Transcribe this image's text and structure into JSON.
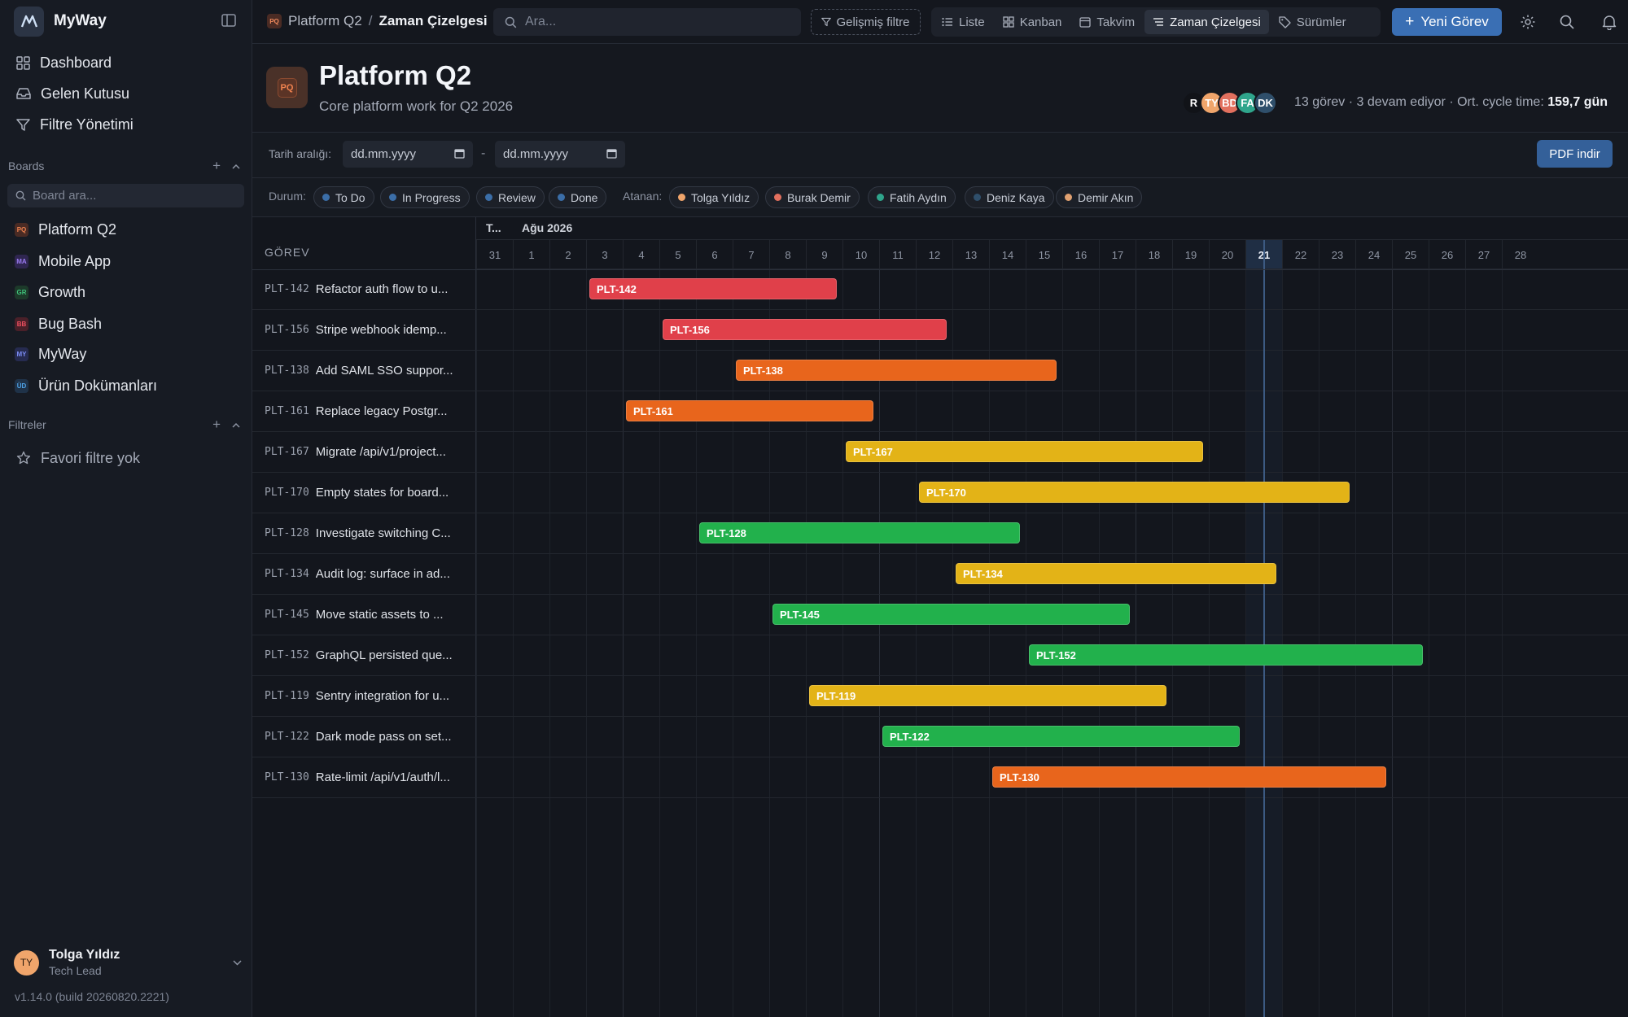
{
  "sidebar": {
    "brand": "MyWay",
    "nav": [
      {
        "label": "Dashboard",
        "icon": "grid-icon"
      },
      {
        "label": "Gelen Kutusu",
        "icon": "inbox-icon"
      },
      {
        "label": "Filtre Yönetimi",
        "icon": "filter-icon"
      }
    ],
    "boards_label": "Boards",
    "board_search_placeholder": "Board ara...",
    "boards": [
      {
        "label": "Platform Q2",
        "chip": "PQ",
        "color": "#f0834f",
        "bg": "#4a2b24"
      },
      {
        "label": "Mobile App",
        "chip": "MA",
        "color": "#9b7bf2",
        "bg": "#2f2650"
      },
      {
        "label": "Growth",
        "chip": "GR",
        "color": "#3fc07a",
        "bg": "#1d3a2a"
      },
      {
        "label": "Bug Bash",
        "chip": "BB",
        "color": "#ef5060",
        "bg": "#4a2029"
      },
      {
        "label": "MyWay",
        "chip": "MY",
        "color": "#7b8cf2",
        "bg": "#262b50"
      },
      {
        "label": "Ürün Dokümanları",
        "chip": "ÜD",
        "color": "#4fa3e8",
        "bg": "#1f3248"
      }
    ],
    "filters_label": "Filtreler",
    "no_favorites": "Favori filtre yok",
    "user": {
      "initials": "TY",
      "name": "Tolga Yıldız",
      "role": "Tech Lead"
    },
    "version": "v1.14.0 (build 20260820.2221)"
  },
  "topbar": {
    "breadcrumb_chip": "PQ",
    "breadcrumb_project": "Platform Q2",
    "breadcrumb_sep": "/",
    "breadcrumb_page": "Zaman Çizelgesi",
    "search_placeholder": "Ara...",
    "advanced_filter": "Gelişmiş filtre",
    "views": [
      {
        "label": "Liste",
        "icon": "list-icon",
        "active": false
      },
      {
        "label": "Kanban",
        "icon": "kanban-icon",
        "active": false
      },
      {
        "label": "Takvim",
        "icon": "calendar-icon",
        "active": false
      },
      {
        "label": "Zaman Çizelgesi",
        "icon": "timeline-icon",
        "active": true
      },
      {
        "label": "Sürümler",
        "icon": "tag-icon",
        "active": false
      }
    ],
    "new_task": "Yeni Görev"
  },
  "project": {
    "chip": "PQ",
    "title": "Platform Q2",
    "subtitle": "Core platform work for Q2 2026",
    "avatars": [
      {
        "initials": "R",
        "color": "#111318"
      },
      {
        "initials": "TY",
        "color": "#f0a56b"
      },
      {
        "initials": "BD",
        "color": "#e2705e"
      },
      {
        "initials": "FA",
        "color": "#2fa58c"
      },
      {
        "initials": "DK",
        "color": "#2f4f6b"
      }
    ],
    "stats_prefix": "13 görev · 3 devam ediyor · Ort. cycle time:",
    "stats_value": "159,7 gün"
  },
  "date_range": {
    "label": "Tarih aralığı:",
    "from_placeholder": "dd.mm.yyyy",
    "to_placeholder": "dd.mm.yyyy",
    "dash": "-",
    "pdf": "PDF indir"
  },
  "filters": {
    "status_label": "Durum:",
    "statuses": [
      {
        "label": "To Do",
        "color": "#3b6ea8"
      },
      {
        "label": "In Progress",
        "color": "#3b6ea8"
      },
      {
        "label": "Review",
        "color": "#3b6ea8"
      },
      {
        "label": "Done",
        "color": "#3b6ea8"
      }
    ],
    "assignee_label": "Atanan:",
    "assignees": [
      {
        "label": "Tolga Yıldız",
        "color": "#f0a56b"
      },
      {
        "label": "Burak Demir",
        "color": "#e2705e"
      },
      {
        "label": "Fatih Aydın",
        "color": "#2fa58c"
      },
      {
        "label": "Deniz Kaya",
        "color": "#2f4f6b"
      },
      {
        "label": "Demir Akın",
        "color": "#e0a070"
      }
    ]
  },
  "gantt": {
    "task_header": "GÖREV",
    "prev_month_label": "T...",
    "month_label": "Ağu 2026",
    "days": [
      "31",
      "1",
      "2",
      "3",
      "4",
      "5",
      "6",
      "7",
      "8",
      "9",
      "10",
      "11",
      "12",
      "13",
      "14",
      "15",
      "16",
      "17",
      "18",
      "19",
      "20",
      "21",
      "22",
      "23",
      "24",
      "25",
      "26",
      "27",
      "28"
    ],
    "today": "21",
    "tasks": [
      {
        "key": "PLT-142",
        "title": "Refactor auth flow to u...",
        "start": "3",
        "end": "9",
        "color": "#e0404a"
      },
      {
        "key": "PLT-156",
        "title": "Stripe webhook idemp...",
        "start": "5",
        "end": "12",
        "color": "#e0404a"
      },
      {
        "key": "PLT-138",
        "title": "Add SAML SSO suppor...",
        "start": "7",
        "end": "15",
        "color": "#e8651c"
      },
      {
        "key": "PLT-161",
        "title": "Replace legacy Postgr...",
        "start": "4",
        "end": "10",
        "color": "#e8651c"
      },
      {
        "key": "PLT-167",
        "title": "Migrate /api/v1/project...",
        "start": "10",
        "end": "19",
        "color": "#e3b317"
      },
      {
        "key": "PLT-170",
        "title": "Empty states for board...",
        "start": "12",
        "end": "23",
        "color": "#e3b317"
      },
      {
        "key": "PLT-128",
        "title": "Investigate switching C...",
        "start": "6",
        "end": "14",
        "color": "#22b14c"
      },
      {
        "key": "PLT-134",
        "title": "Audit log: surface in ad...",
        "start": "13",
        "end": "21",
        "color": "#e3b317"
      },
      {
        "key": "PLT-145",
        "title": "Move static assets to ...",
        "start": "8",
        "end": "17",
        "color": "#22b14c"
      },
      {
        "key": "PLT-152",
        "title": "GraphQL persisted que...",
        "start": "15",
        "end": "25",
        "color": "#22b14c"
      },
      {
        "key": "PLT-119",
        "title": "Sentry integration for u...",
        "start": "9",
        "end": "18",
        "color": "#e3b317"
      },
      {
        "key": "PLT-122",
        "title": "Dark mode pass on set...",
        "start": "11",
        "end": "20",
        "color": "#22b14c"
      },
      {
        "key": "PLT-130",
        "title": "Rate-limit /api/v1/auth/l...",
        "start": "14",
        "end": "24",
        "color": "#e8651c"
      }
    ]
  }
}
